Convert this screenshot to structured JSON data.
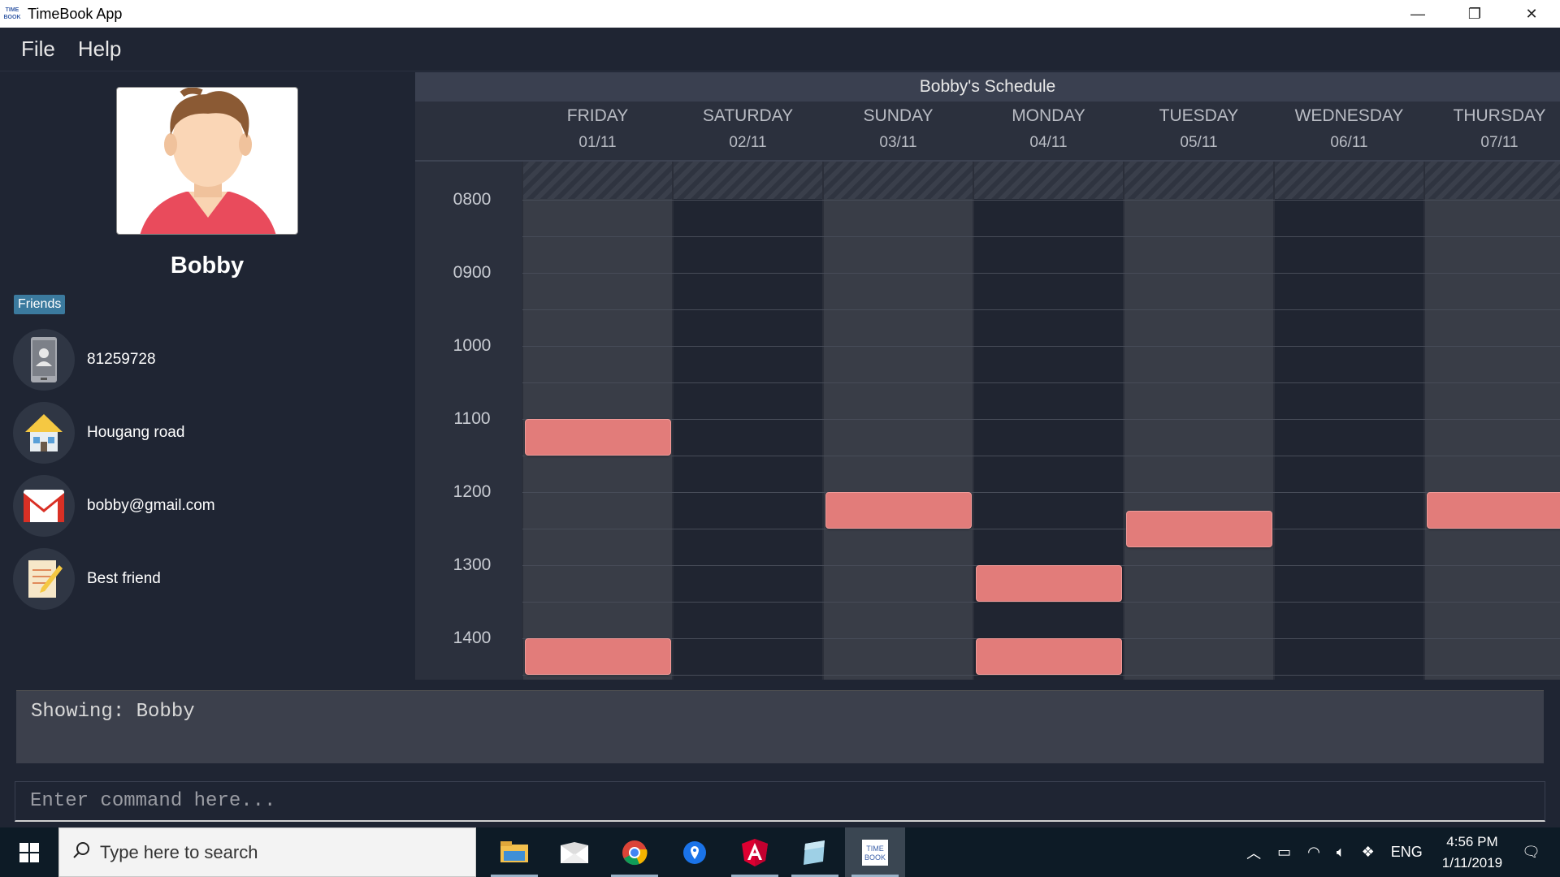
{
  "window": {
    "title": "TimeBook App",
    "app_icon_text": "TIME BOOK",
    "controls": [
      "—",
      "❐",
      "✕"
    ]
  },
  "menu": {
    "items": [
      "File",
      "Help"
    ]
  },
  "profile": {
    "name": "Bobby",
    "friends_tag": "Friends",
    "phone": "81259728",
    "address": "Hougang road",
    "email": "bobby@gmail.com",
    "tag": "Best friend",
    "icons": [
      "phone-icon",
      "house-icon",
      "gmail-icon",
      "note-icon"
    ]
  },
  "schedule": {
    "title": "Bobby's Schedule",
    "days": [
      {
        "name": "FRIDAY",
        "date": "01/11"
      },
      {
        "name": "SATURDAY",
        "date": "02/11"
      },
      {
        "name": "SUNDAY",
        "date": "03/11"
      },
      {
        "name": "MONDAY",
        "date": "04/11"
      },
      {
        "name": "TUESDAY",
        "date": "05/11"
      },
      {
        "name": "WEDNESDAY",
        "date": "06/11"
      },
      {
        "name": "THURSDAY",
        "date": "07/11"
      }
    ],
    "hours": [
      "0800",
      "0900",
      "1000",
      "1100",
      "1200",
      "1300",
      "1400"
    ],
    "events": [
      {
        "day": 0,
        "start": "1100"
      },
      {
        "day": 0,
        "start": "1400"
      },
      {
        "day": 2,
        "start": "1200"
      },
      {
        "day": 3,
        "start": "1300"
      },
      {
        "day": 3,
        "start": "1400"
      },
      {
        "day": 4,
        "start": "1215"
      },
      {
        "day": 6,
        "start": "1200"
      }
    ],
    "event_color": "#e27c7a"
  },
  "result": {
    "text": "Showing: Bobby"
  },
  "command": {
    "placeholder": "Enter command here..."
  },
  "taskbar": {
    "search_placeholder": "Type here to search",
    "apps": [
      "file-explorer-icon",
      "mail-icon",
      "chrome-icon",
      "maps-icon",
      "angular-icon",
      "notes-icon",
      "timebook-icon"
    ],
    "language": "ENG",
    "time": "4:56 PM",
    "date": "1/11/2019"
  }
}
